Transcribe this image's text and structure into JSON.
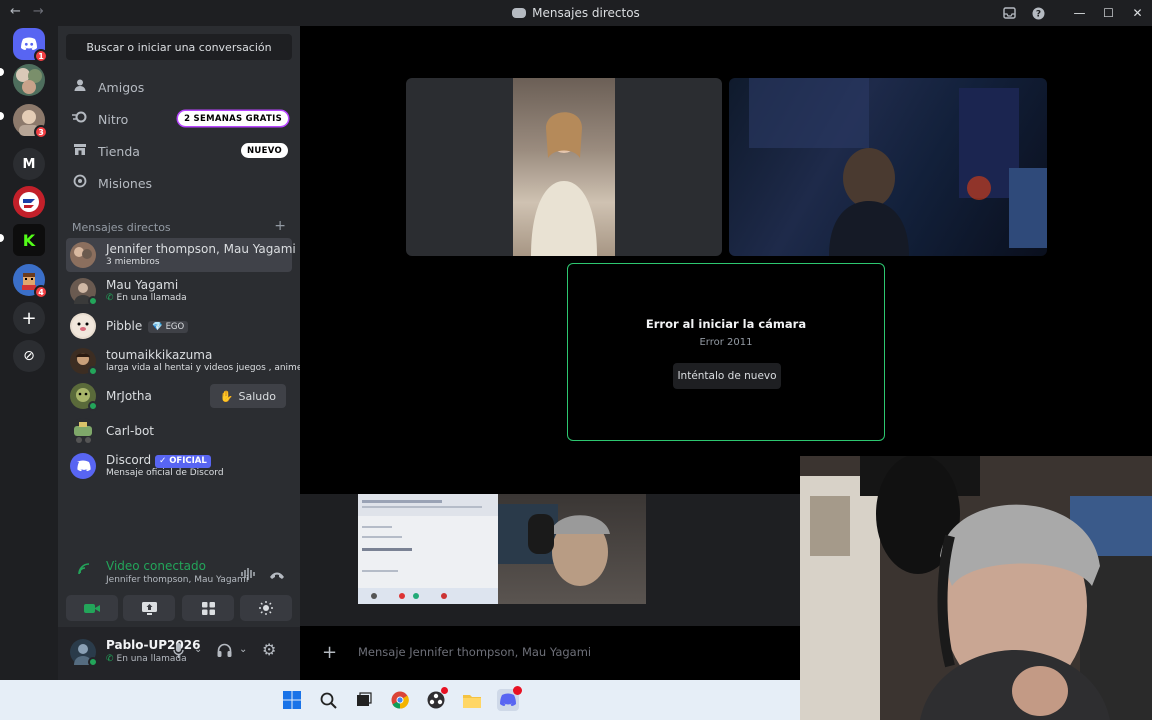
{
  "window": {
    "title": "Mensajes directos",
    "nav_back": "←",
    "nav_forward": "→",
    "inbox_icon": "inbox-icon",
    "help_icon": "help-icon",
    "minimize": "—",
    "maximize": "☐",
    "close": "✕"
  },
  "servers": [
    {
      "name": "discord-home",
      "badge": "1"
    },
    {
      "name": "server-group",
      "badge": ""
    },
    {
      "name": "server-avatar",
      "badge": "3"
    },
    {
      "label": "M"
    },
    {
      "name": "server-red-logo"
    },
    {
      "label": "K"
    },
    {
      "name": "server-pixel",
      "badge": "4"
    },
    {
      "label": "+"
    },
    {
      "label": "⊘"
    }
  ],
  "sidebar": {
    "search_button": "Buscar o iniciar una conversación",
    "nav": [
      {
        "label": "Amigos"
      },
      {
        "label": "Nitro",
        "badge": "2 SEMANAS GRATIS"
      },
      {
        "label": "Tienda",
        "badge": "NUEVO"
      },
      {
        "label": "Misiones"
      }
    ],
    "dm_header": "Mensajes directos",
    "dm_add": "+",
    "dms": [
      {
        "name": "Jennifer thompson, Mau Yagami",
        "sub": "3 miembros"
      },
      {
        "name": "Mau Yagami",
        "sub": "En una llamada"
      },
      {
        "name": "Pibble",
        "tag": "EGO"
      },
      {
        "name": "toumaikkikazuma",
        "sub": "larga vida al hentai y videos juegos , anime"
      },
      {
        "name": "MrJotha",
        "action": "Saludo"
      },
      {
        "name": "Carl-bot"
      },
      {
        "name": "Discord",
        "tag": "OFICIAL",
        "sub": "Mensaje oficial de Discord"
      }
    ]
  },
  "voice": {
    "status": "Video conectado",
    "channel": "Jennifer thompson, Mau Yagami"
  },
  "user": {
    "name": "Pablo-UP2026",
    "status": "En una llamada"
  },
  "call": {
    "error_title": "Error al iniciar la cámara",
    "error_code": "Error 2011",
    "retry_button": "Inténtalo de nuevo"
  },
  "composer": {
    "placeholder": "Mensaje Jennifer thompson, Mau Yagami"
  },
  "colors": {
    "accent": "#5865f2",
    "online": "#23a55a",
    "danger": "#f23f43",
    "camera_error_border": "#2dc770"
  }
}
